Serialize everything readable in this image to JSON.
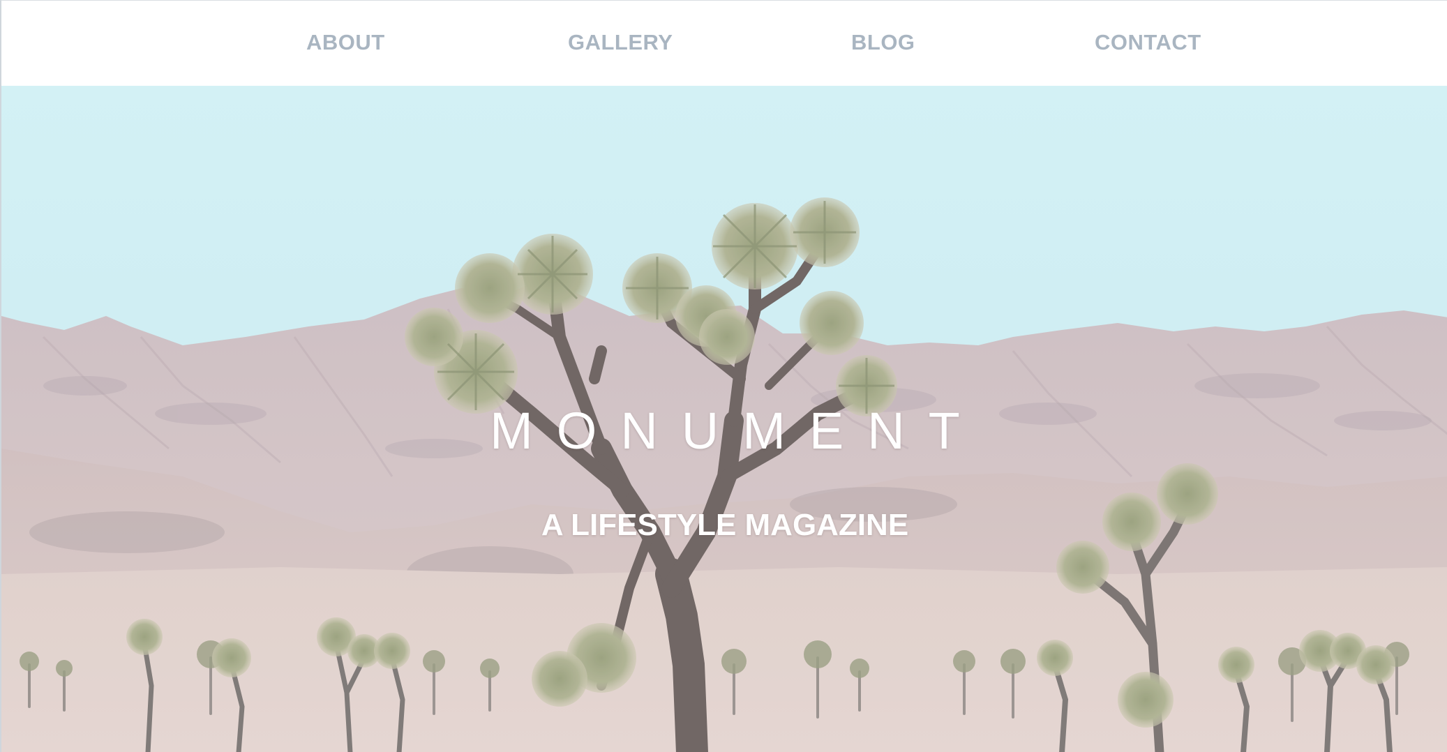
{
  "nav": {
    "items": [
      {
        "label": "ABOUT"
      },
      {
        "label": "GALLERY"
      },
      {
        "label": "BLOG"
      },
      {
        "label": "CONTACT"
      }
    ]
  },
  "hero": {
    "title": "MONUMENT",
    "tagline": "A LIFESTYLE MAGAZINE",
    "image_subject": "desert landscape with joshua trees and mountains"
  },
  "colors": {
    "nav_text": "#a9b5c1",
    "nav_bg": "#ffffff",
    "sky": "#cdeef3",
    "hero_text": "#ffffff"
  }
}
